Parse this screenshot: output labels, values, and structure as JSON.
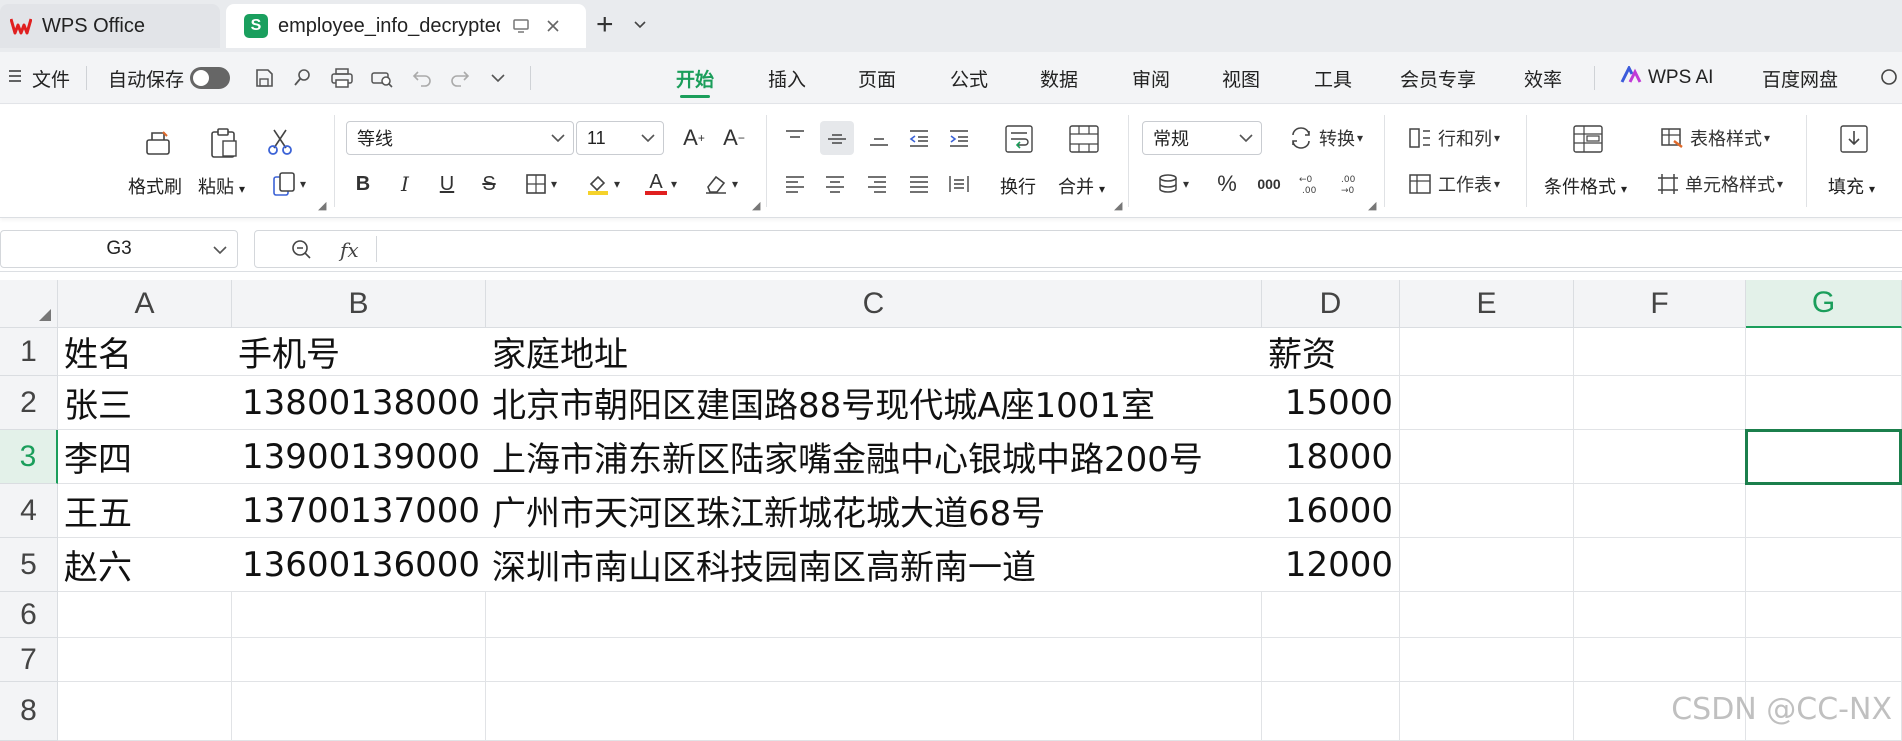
{
  "window": {
    "tabs": [
      {
        "label": "WPS Office"
      },
      {
        "label": "employee_info_decrypted"
      }
    ],
    "add_tab_symbol": "+"
  },
  "menubar": {
    "file_label": "文件",
    "autosave_label": "自动保存",
    "tabs": [
      {
        "label": "开始",
        "active": true
      },
      {
        "label": "插入"
      },
      {
        "label": "页面"
      },
      {
        "label": "公式"
      },
      {
        "label": "数据"
      },
      {
        "label": "审阅"
      },
      {
        "label": "视图"
      },
      {
        "label": "工具"
      },
      {
        "label": "会员专享"
      },
      {
        "label": "效率"
      },
      {
        "label": "WPS AI"
      },
      {
        "label": "百度网盘"
      }
    ]
  },
  "ribbon": {
    "format_painter": "格式刷",
    "paste": "粘贴",
    "font_name": "等线",
    "font_size": "11",
    "wrap_text": "换行",
    "merge": "合并",
    "number_format": "常规",
    "convert": "转换",
    "rows_cols": "行和列",
    "worksheet": "工作表",
    "conditional_format": "条件格式",
    "table_style": "表格样式",
    "cell_style": "单元格样式",
    "fill": "填充",
    "bold": "B",
    "italic": "I",
    "underline": "U",
    "strike": "S",
    "font_color_letter": "A",
    "percent": "%",
    "thousands": "000"
  },
  "formula_bar": {
    "cell_ref": "G3",
    "fx": "fx",
    "formula": ""
  },
  "sheet": {
    "columns": [
      "A",
      "B",
      "C",
      "D",
      "E",
      "F",
      "G"
    ],
    "rows": [
      "1",
      "2",
      "3",
      "4",
      "5",
      "6",
      "7",
      "8"
    ],
    "selected_cell": "G3",
    "data": [
      [
        "姓名",
        "手机号",
        "家庭地址",
        "薪资"
      ],
      [
        "张三",
        "13800138000",
        "北京市朝阳区建国路88号现代城A座1001室",
        "15000"
      ],
      [
        "李四",
        "13900139000",
        "上海市浦东新区陆家嘴金融中心银城中路200号",
        "18000"
      ],
      [
        "王五",
        "13700137000",
        "广州市天河区珠江新城花城大道68号",
        "16000"
      ],
      [
        "赵六",
        "13600136000",
        "深圳市南山区科技园南区高新南一道",
        "12000"
      ]
    ]
  },
  "watermark": "CSDN @CC-NX"
}
